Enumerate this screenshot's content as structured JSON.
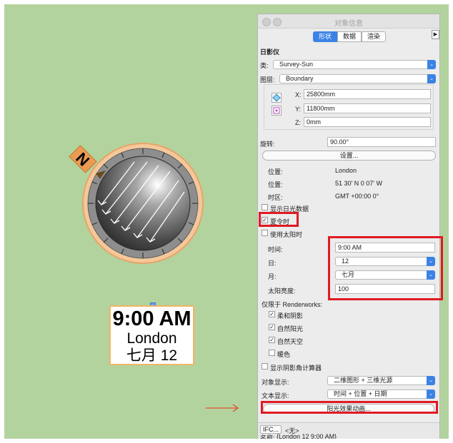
{
  "canvas": {
    "north_label": "N",
    "label": {
      "time": "9:00 AM",
      "city": "London",
      "date": "七月 12"
    }
  },
  "palette": {
    "title": "对象信息",
    "tabs": [
      {
        "label": "形状",
        "active": true
      },
      {
        "label": "数据"
      },
      {
        "label": "渲染"
      }
    ],
    "object_type": "日影仪",
    "class_label": "类:",
    "class_value": "Survey-Sun",
    "layer_label": "图层:",
    "layer_value": "Boundary",
    "x_label": "X:",
    "x_value": "25800mm",
    "y_label": "Y:",
    "y_value": "11800mm",
    "z_label": "Z:",
    "z_value": "0mm",
    "rotation_label": "旋转:",
    "rotation_value": "90.00°",
    "settings_button": "设置...",
    "location_label": "位置:",
    "location_value": "London",
    "position_label": "位置:",
    "position_value": "51 30' N  0 07' W",
    "timezone_label": "时区:",
    "timezone_value": "GMT +00:00 0°",
    "show_solar_data": {
      "label": "显示日光数据",
      "checked": false
    },
    "daylight_saving": {
      "label": "夏令时",
      "checked": true
    },
    "use_solar_time": {
      "label": "使用太阳时",
      "checked": false
    },
    "time_label": "时间:",
    "time_value": "9:00 AM",
    "day_label": "日:",
    "day_value": "12",
    "month_label": "月:",
    "month_value": "七月",
    "brightness_label": "太阳亮度:",
    "brightness_value": "100",
    "renderworks_label": "仅限于 Renderworks:",
    "soft_shadows": {
      "label": "柔和阴影",
      "checked": true
    },
    "natural_light": {
      "label": "自然阳光",
      "checked": true
    },
    "natural_sky": {
      "label": "自然天空",
      "checked": true
    },
    "warm_color": {
      "label": "暖色",
      "checked": false
    },
    "show_shadow_calc": {
      "label": "显示阴影角计算器",
      "checked": false
    },
    "object_display_label": "对象显示:",
    "object_display_value": "二维图形 + 三维光源",
    "text_display_label": "文本显示:",
    "text_display_value": "时间 + 位置 + 日期",
    "animation_button": "阳光效果动画...",
    "ifc_button": "IFC...",
    "ifc_value": "<无>",
    "name_label": "名称:",
    "name_value": "{London 12  9:00 AM}"
  },
  "colors": {
    "annotation_red": "#e01a22",
    "accent_blue": "#3b82e5",
    "canvas_green": "#b3d39e",
    "label_border": "#f2b46a"
  }
}
